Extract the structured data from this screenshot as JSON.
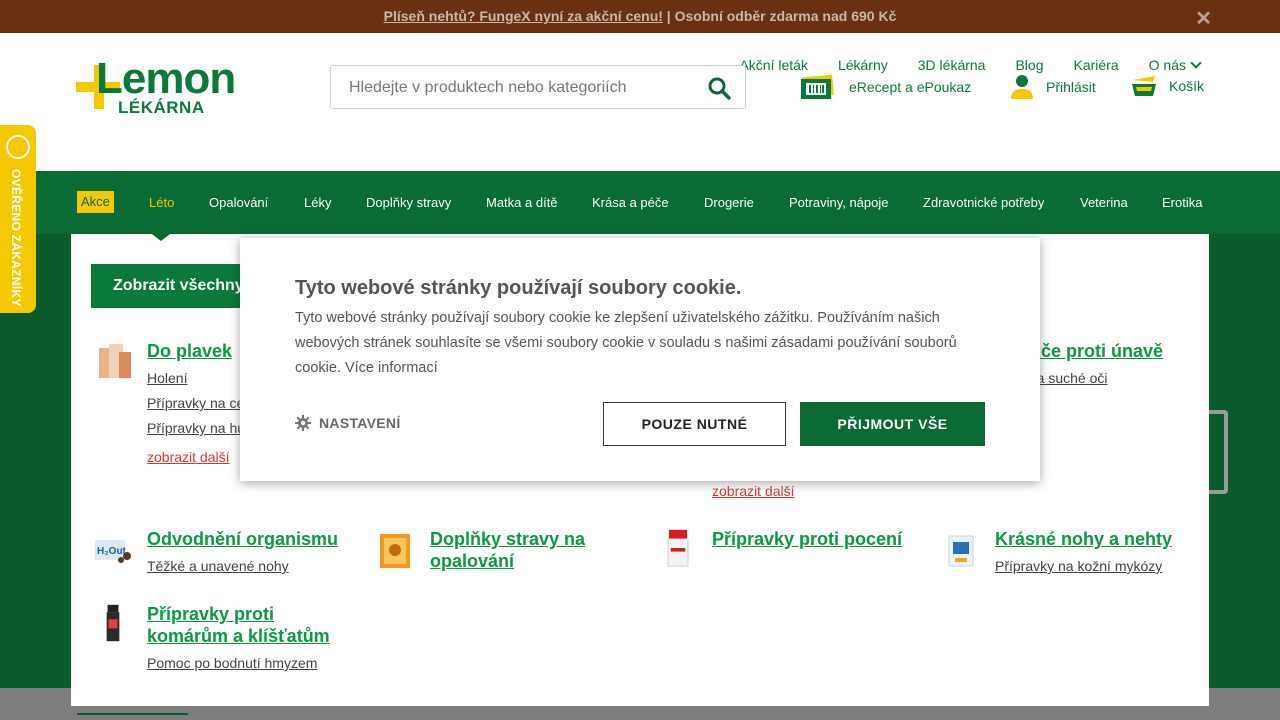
{
  "promo": {
    "link": "Plíseň nehtů? FungeX nyní za akční cenu!",
    "separator": " | ",
    "text": "Osobní odběr zdarma nad 690 Kč",
    "close": "✕"
  },
  "topnav": [
    "Akční leták",
    "Lékárny",
    "3D lékárna",
    "Blog",
    "Kariéra",
    "O nás"
  ],
  "logo": {
    "word": "Lemon",
    "sub": "LÉKÁRNA"
  },
  "search": {
    "placeholder": "Hledejte v produktech nebo kategoriích"
  },
  "header_actions": {
    "erecept": "eRecept a ePoukaz",
    "login": "Přihlásit",
    "cart": "Košík"
  },
  "mainnav": [
    "Akce",
    "Léto",
    "Opalování",
    "Léky",
    "Doplňky stravy",
    "Matka a dítě",
    "Krása a péče",
    "Drogerie",
    "Potraviny, nápoje",
    "Zdravotnické potřeby",
    "Veterina",
    "Erotika"
  ],
  "mega": {
    "show_all": "Zobrazit všechny",
    "categories": [
      {
        "title": "Do plavek",
        "subs": [
          "Holení",
          "Přípravky na ce",
          "Přípravky na hu"
        ],
        "more": "zobrazit další"
      },
      {
        "title": "diče proti únavě",
        "subs": [
          "é a suché oči"
        ],
        "more": "zobrazit další"
      },
      {
        "title": "Odvodnění organismu",
        "subs": [
          "Těžké a unavené nohy"
        ]
      },
      {
        "title": "Doplňky stravy na opalování",
        "subs": []
      },
      {
        "title": "Přípravky proti pocení",
        "subs": []
      },
      {
        "title": "Krásné nohy a nehty",
        "subs": [
          "Přípravky na kožní mykózy"
        ]
      },
      {
        "title": "Přípravky proti komárům a klíšťatům",
        "subs": [
          "Pomoc po bodnutí hmyzem"
        ]
      }
    ]
  },
  "verified_badge": "OVĚŘENO ZÁKAZNÍKY",
  "cookie": {
    "title": "Tyto webové stránky používají soubory cookie.",
    "text": "Tyto webové stránky používají soubory cookie ke zlepšení uživatelského zážitku. Používáním našich webových stránek souhlasíte se všemi soubory cookie v souladu s našimi zásadami používání souborů cookie. Více informací",
    "settings": "NASTAVENÍ",
    "necessary": "POUZE NUTNÉ",
    "accept": "PŘIJMOUT VŠE"
  },
  "colors": {
    "brand_green": "#0a7a3b",
    "nav_green": "#0a6b35",
    "brand_yellow": "#f5c800",
    "promo_bg": "#6b2f12",
    "link_red": "#e2332f"
  }
}
